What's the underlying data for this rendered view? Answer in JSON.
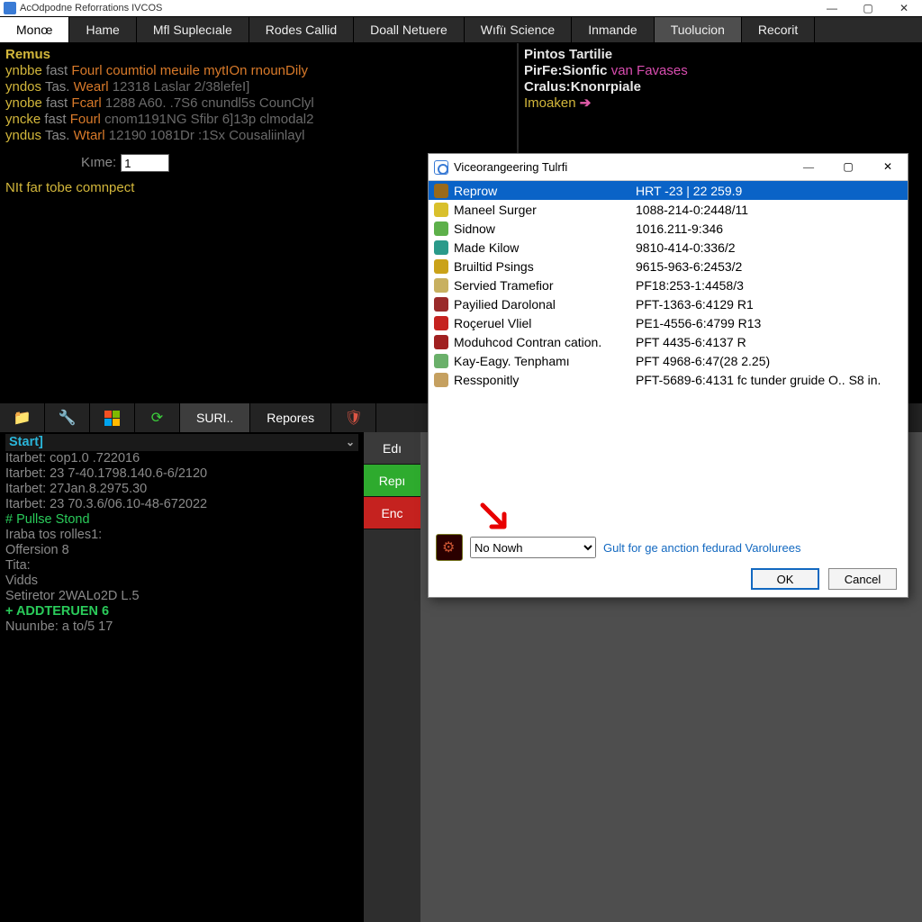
{
  "main_window": {
    "title": "AcOdpodne Reforrations IVCOS",
    "tabs": [
      "Monœ",
      "Hame",
      "Mfl Suplecıale",
      "Rodes Callid",
      "Doall Netuere",
      "Wıfïı Science",
      "Inmande",
      "Tuolucion",
      "Recorit"
    ]
  },
  "upper_left": {
    "heading": "Remus",
    "rows": [
      {
        "a": "ynbbe",
        "b": "fast",
        "c": "Fourl",
        "d": "coumtiol meuile mytIOn rnounDily"
      },
      {
        "a": "yndos",
        "b": "Tas.",
        "c": "Wearl",
        "d": "12318 Laslar 2/38lefeI]"
      },
      {
        "a": "ynobe",
        "b": "fast",
        "c": "Fcarl",
        "d": "1288 A60.    .7S6 cnundl5s CounClyl"
      },
      {
        "a": "yncke",
        "b": "fast",
        "c": "Fourl",
        "d": "cnom1191NG Sfibr 6]13p clmodal2"
      },
      {
        "a": "yndus",
        "b": "Tas.",
        "c": "Wtarl",
        "d": "12190 1081Dr  :1Sx Cousaliinlayl"
      }
    ],
    "kme_label": "Kıme:",
    "kme_value": "1",
    "footer": "NIt far tobe comnpect"
  },
  "upper_right": {
    "l1a": "Pintos",
    "l1b": "Tartilie",
    "l2a": "PirFe:",
    "l2b": "Sionfic",
    "l2c": "van Favases",
    "l3a": "Cralus:",
    "l3b": "Knonrpiale",
    "l4a": "Imoaken",
    "l4arrow": "➔"
  },
  "midbar": {
    "btn_text1": "SURI..",
    "btn_text2": "Repores"
  },
  "terminal": {
    "header": "Start]",
    "lines": [
      {
        "t": "Itarbet: cop1.0 .722016",
        "c": "c-gray"
      },
      {
        "t": "Itarbet: 23 7-40.1798.140.6-6/2120",
        "c": "c-gray"
      },
      {
        "t": "Itarbet: 27Jan.8.2975.30",
        "c": "c-gray"
      },
      {
        "t": "Itarbet: 23 70.3.6/06.10-48-672022",
        "c": "c-gray"
      },
      {
        "t": "# Pullse Stond",
        "c": "c-green"
      },
      {
        "t": "Iraba tos rolles1:",
        "c": "c-gray"
      },
      {
        "t": "Offersion 8",
        "c": "c-gray"
      },
      {
        "t": "Tita:",
        "c": "c-gray"
      },
      {
        "t": "Vidds",
        "c": "c-gray"
      },
      {
        "t": "Setiretor 2WALo2D L.5",
        "c": "c-gray"
      },
      {
        "t": "+ ADDTERUEN 6",
        "c": "c-green"
      },
      {
        "t": "Nuunıbe: a to/5 17",
        "c": "c-gray"
      }
    ]
  },
  "sidebar2": {
    "b1": "Edı",
    "b2": "Repı",
    "b3": "Enc"
  },
  "dialog": {
    "title": "Viceorangeering Tulrfi",
    "rows": [
      {
        "icon": "ic-brown",
        "label": "Reprow",
        "value": "HRT -23 | 22 259.9"
      },
      {
        "icon": "ic-yellow",
        "label": "Maneel Surger",
        "value": "1088-214-0:2448/11"
      },
      {
        "icon": "ic-green",
        "label": "Sidnow",
        "value": "1016.211-9:346"
      },
      {
        "icon": "ic-teal",
        "label": "Made Kilow",
        "value": "9810-414-0:336/2"
      },
      {
        "icon": "ic-gold",
        "label": "Bruiltid Psings",
        "value": "9615-963-6:2453/2"
      },
      {
        "icon": "ic-sand",
        "label": "Servied Tramefior",
        "value": "PF18:253-1:4458/3"
      },
      {
        "icon": "ic-maroon",
        "label": "Payilied Darolonal",
        "value": "PFT-1363-6:4129 R1"
      },
      {
        "icon": "ic-red",
        "label": "Roçeruel Vliel",
        "value": "PE1-4556-6:4799 R13"
      },
      {
        "icon": "ic-dred",
        "label": "Moduhcod Contran cation.",
        "value": "PFT 4435-6:4137 R"
      },
      {
        "icon": "ic-greenbox",
        "label": "Kay-Eagy. Tenphamı",
        "value": "PFT 4968-6:47(28 2.25)"
      },
      {
        "icon": "ic-tan",
        "label": "Ressponitly",
        "value": "PFT-5689-6:4131 fc tunder gruide O.. S8 in."
      }
    ],
    "select_value": "No Nowh",
    "link": "Gult for ge anction fedurad Varolurees",
    "ok": "OK",
    "cancel": "Cancel"
  }
}
